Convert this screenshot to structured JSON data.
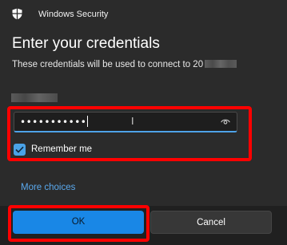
{
  "window": {
    "app_title": "Windows Security",
    "shield_icon": "shield-icon"
  },
  "dialog": {
    "heading": "Enter your credentials",
    "subtitle": "These credentials will be used to connect to 20"
  },
  "password_field": {
    "value_masked": "•••••••••••",
    "reveal_icon": "eye-icon"
  },
  "remember_me": {
    "label": "Remember me",
    "checked": true
  },
  "links": {
    "more_choices": "More choices"
  },
  "buttons": {
    "ok": "OK",
    "cancel": "Cancel"
  },
  "colors": {
    "accent": "#1987e6",
    "link": "#5aa9ee",
    "annotation_red": "#ff0000",
    "background": "#2b2b2b",
    "footer": "#202020"
  }
}
